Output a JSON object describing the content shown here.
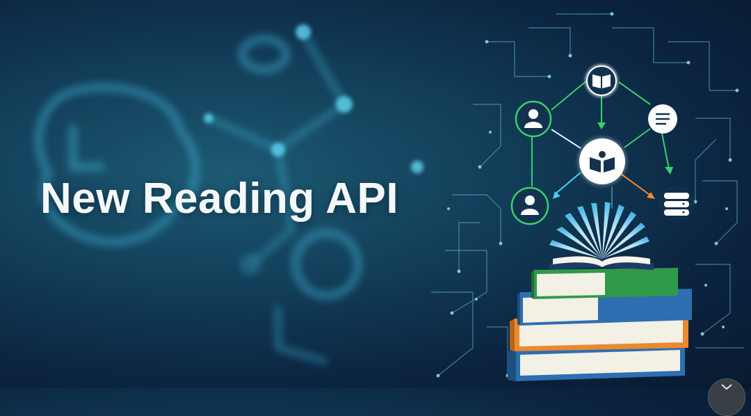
{
  "banner": {
    "title": "New Reading API"
  },
  "colors": {
    "background_dark": "#0b2440",
    "background_teal": "#1d5a73",
    "network_green": "#38d26a",
    "network_orange": "#f08a3a",
    "network_cyan": "#4fd0f0",
    "book_green": "#2f9a4a",
    "book_blue": "#2d6fb0",
    "book_orange": "#e98a2f",
    "title_text": "#f4f8fb"
  },
  "icons": {
    "network_nodes": [
      "open-book-icon",
      "user-icon",
      "list-icon",
      "reading-book-icon",
      "user-icon",
      "database-icon"
    ],
    "background": "head-profile-network-icon",
    "floating_button": "chevron-down-icon"
  }
}
